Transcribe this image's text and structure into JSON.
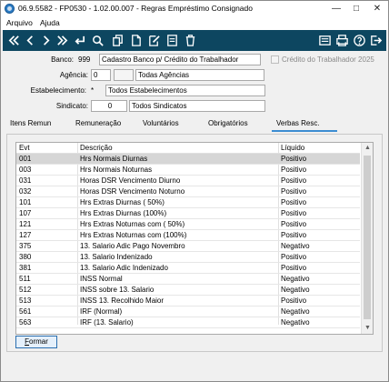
{
  "window": {
    "title": "06.9.5582 - FP0530 - 1.02.00.007 - Regras Empréstimo Consignado",
    "minimize": "—",
    "maximize": "□",
    "close": "✕"
  },
  "menu": {
    "items": [
      "Arquivo",
      "Ajuda"
    ]
  },
  "toolbar": {
    "icons": [
      "first-icon",
      "previous-icon",
      "next-icon",
      "last-icon",
      "return-icon",
      "search-icon",
      "copy-icon",
      "paste-icon",
      "edit-icon",
      "new-icon",
      "delete-icon",
      "report-icon",
      "print-icon",
      "help-icon",
      "exit-icon"
    ],
    "background": "#0d4660"
  },
  "form": {
    "banco": {
      "label": "Banco:",
      "code": "999",
      "name": "Cadastro Banco p/ Crédito do Trabalhador"
    },
    "agencia": {
      "label": "Agência:",
      "code": "0",
      "name": "Todas Agências"
    },
    "estabelecimento": {
      "label": "Estabelecimento:",
      "code": "*",
      "name": "Todos Estabelecimentos"
    },
    "sindicato": {
      "label": "Sindicato:",
      "code": "0",
      "name": "Todos Sindicatos"
    },
    "checkbox_label": "Crédito do Trabalhador 2025"
  },
  "tabs": [
    "Itens Remun",
    "Remuneração",
    "Voluntários",
    "Obrigatórios",
    "Verbas Resc."
  ],
  "active_tab": "Verbas Resc.",
  "grid": {
    "headers": [
      "Evt",
      "Descrição",
      "Líquido"
    ],
    "rows": [
      {
        "evt": "001",
        "desc": "Hrs Normais Diurnas",
        "liq": "Positivo"
      },
      {
        "evt": "003",
        "desc": "Hrs Normais Noturnas",
        "liq": "Positivo"
      },
      {
        "evt": "031",
        "desc": "Horas DSR Vencimento Diurno",
        "liq": "Positivo"
      },
      {
        "evt": "032",
        "desc": "Horas DSR Vencimento Noturno",
        "liq": "Positivo"
      },
      {
        "evt": "101",
        "desc": "Hrs Extras Diurnas ( 50%)",
        "liq": "Positivo"
      },
      {
        "evt": "107",
        "desc": "Hrs Extras Diurnas (100%)",
        "liq": "Positivo"
      },
      {
        "evt": "121",
        "desc": "Hrs Extras Noturnas com ( 50%)",
        "liq": "Positivo"
      },
      {
        "evt": "127",
        "desc": "Hrs Extras Noturnas com (100%)",
        "liq": "Positivo"
      },
      {
        "evt": "375",
        "desc": "13. Salario Adic Pago Novembro",
        "liq": "Negativo"
      },
      {
        "evt": "380",
        "desc": "13. Salario Indenizado",
        "liq": "Positivo"
      },
      {
        "evt": "381",
        "desc": "13. Salario Adic Indenizado",
        "liq": "Positivo"
      },
      {
        "evt": "511",
        "desc": "INSS Normal",
        "liq": "Negativo"
      },
      {
        "evt": "512",
        "desc": "INSS sobre 13. Salario",
        "liq": "Negativo"
      },
      {
        "evt": "513",
        "desc": "INSS 13. Recolhido Maior",
        "liq": "Positivo"
      },
      {
        "evt": "561",
        "desc": "IRF (Normal)",
        "liq": "Negativo"
      },
      {
        "evt": "563",
        "desc": "IRF (13. Salario)",
        "liq": "Negativo"
      }
    ]
  },
  "button": {
    "formar_first": "F",
    "formar_rest": "ormar"
  }
}
